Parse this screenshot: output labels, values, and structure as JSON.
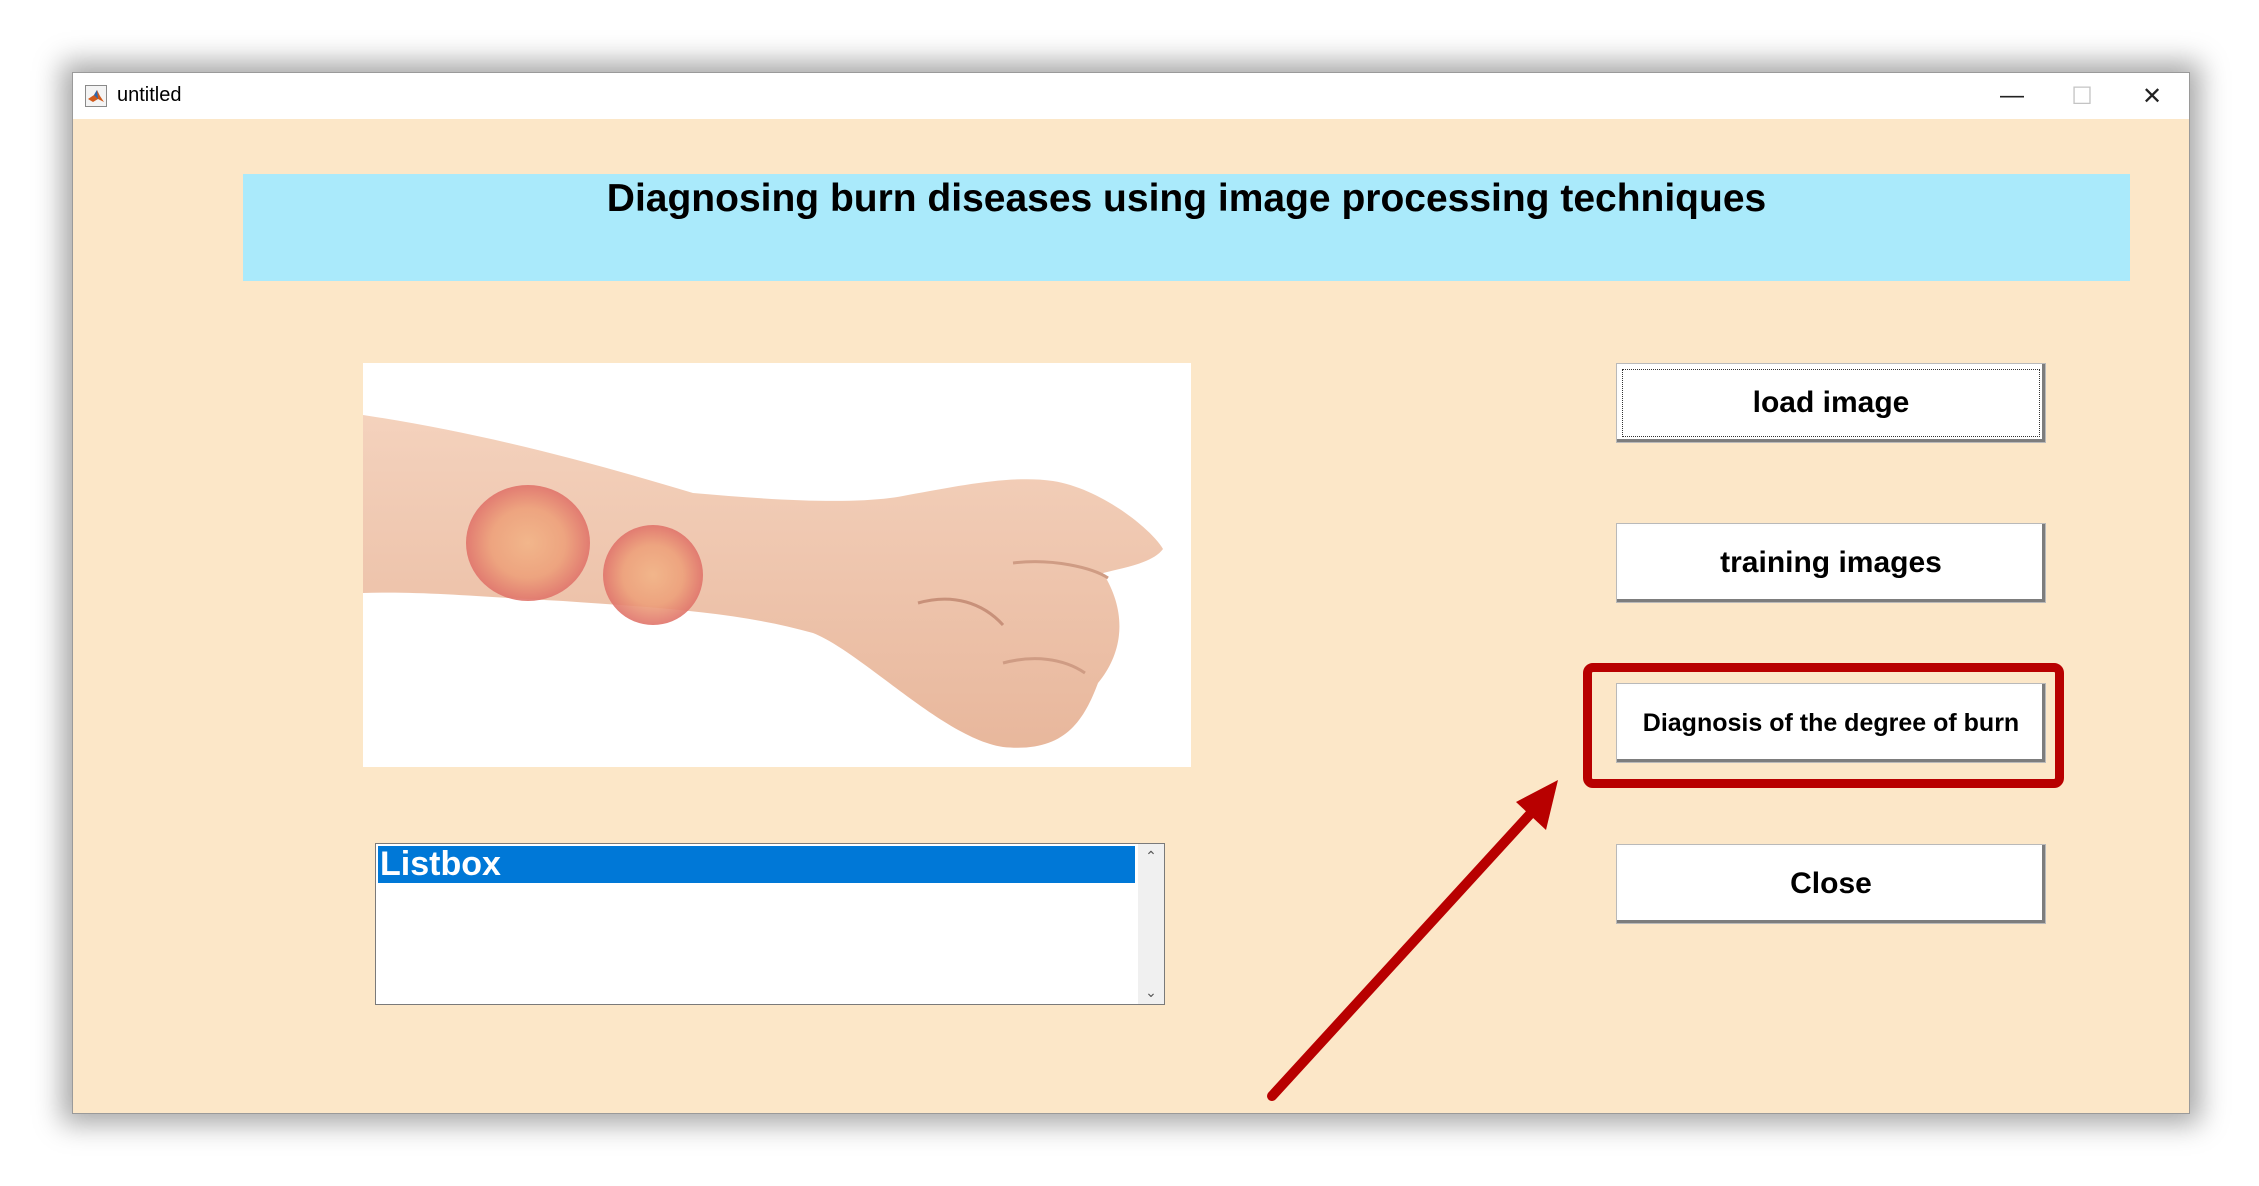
{
  "window": {
    "title": "untitled",
    "minimize_glyph": "—",
    "maximize_glyph": "☐",
    "close_glyph": "✕"
  },
  "banner": {
    "title": "Diagnosing burn diseases using image processing techniques"
  },
  "image": {
    "subject": "forearm and clenched fist with two circular burn marks"
  },
  "buttons": {
    "load": "load image",
    "training": "training images",
    "diagnosis": "Diagnosis of the degree of burn",
    "close": "Close"
  },
  "listbox": {
    "items": [
      "Listbox"
    ],
    "scroll_up": "⌃",
    "scroll_down": "⌄"
  },
  "colors": {
    "background": "#fce7c8",
    "banner": "#aaeafb",
    "highlight": "#b80000",
    "list_selection": "#0078d7"
  }
}
